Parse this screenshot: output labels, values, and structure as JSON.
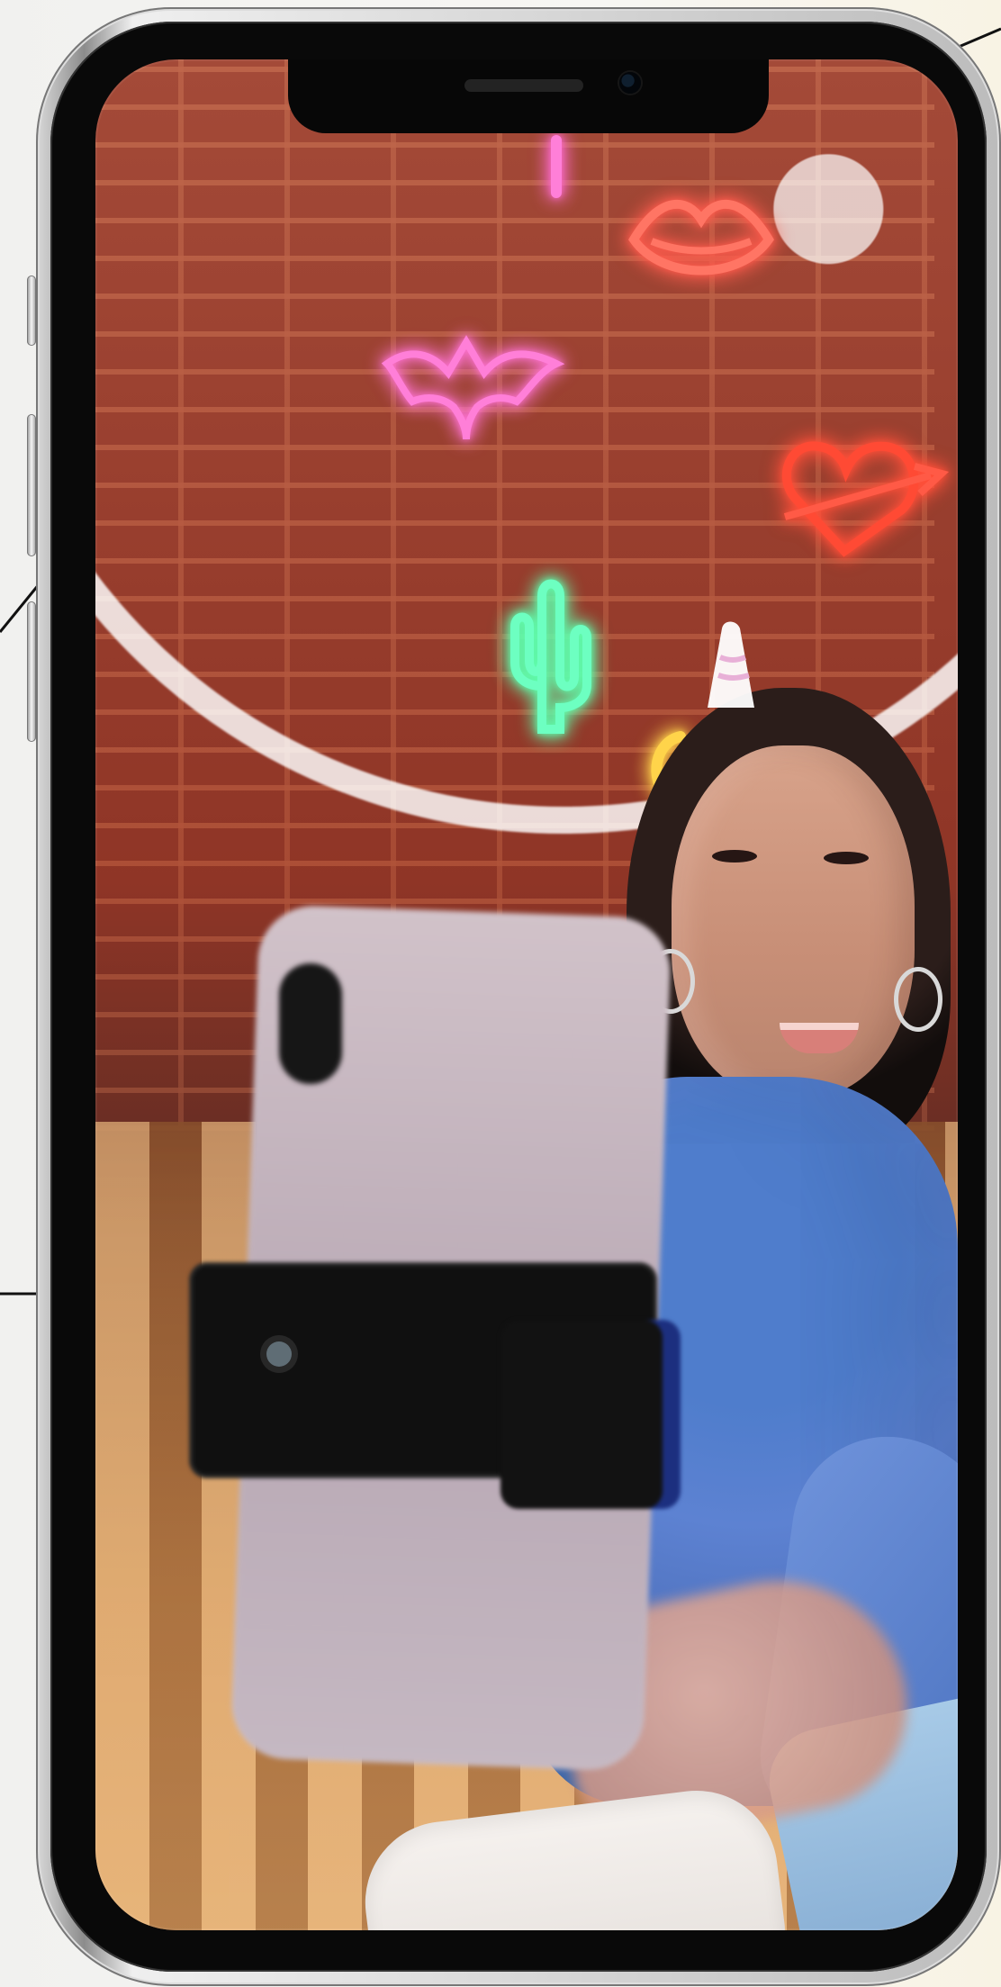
{
  "screen_kind": "phone mockup with live camera scene",
  "colors": {
    "background": "#f3f2ef",
    "phone_frame": "#c8c8c8",
    "neon_pink": "#ff4fb9",
    "neon_red": "#ff4b3a",
    "neon_green": "#64ffb0",
    "neon_yellow": "#ffd44a"
  },
  "icons": {
    "front_camera": "front-camera-icon",
    "speaker": "earpiece-speaker-icon"
  }
}
